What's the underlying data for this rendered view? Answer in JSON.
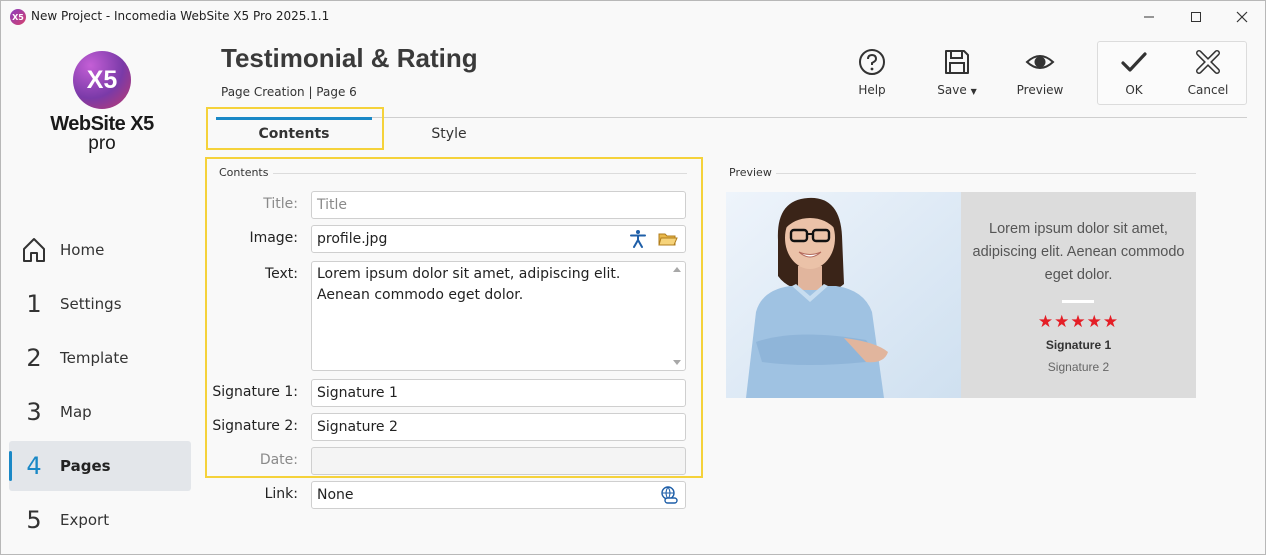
{
  "window": {
    "title": "New Project - Incomedia WebSite X5 Pro 2025.1.1",
    "app_icon_text": "X5"
  },
  "logo": {
    "mark": "X5",
    "name": "WebSite X5",
    "edition": "pro"
  },
  "sidebar": {
    "items": [
      {
        "num": "",
        "label": "Home",
        "icon": "home-icon"
      },
      {
        "num": "1",
        "label": "Settings"
      },
      {
        "num": "2",
        "label": "Template"
      },
      {
        "num": "3",
        "label": "Map"
      },
      {
        "num": "4",
        "label": "Pages",
        "active": true
      },
      {
        "num": "5",
        "label": "Export"
      }
    ]
  },
  "header": {
    "title": "Testimonial & Rating",
    "breadcrumb": "Page Creation | Page 6",
    "toolbar": {
      "help": "Help",
      "save": "Save",
      "preview": "Preview",
      "ok": "OK",
      "cancel": "Cancel"
    }
  },
  "tabs": [
    {
      "label": "Contents",
      "active": true
    },
    {
      "label": "Style",
      "active": false
    }
  ],
  "contents": {
    "section_title": "Contents",
    "title": {
      "label": "Title:",
      "placeholder": "Title"
    },
    "image": {
      "label": "Image:",
      "value": "profile.jpg"
    },
    "text": {
      "label": "Text:",
      "value": "Lorem ipsum dolor sit amet, adipiscing elit. Aenean commodo eget dolor."
    },
    "signature1": {
      "label": "Signature 1:",
      "value": "Signature 1"
    },
    "signature2": {
      "label": "Signature 2:",
      "value": "Signature 2"
    },
    "date": {
      "label": "Date:",
      "value": ""
    },
    "link": {
      "label": "Link:",
      "value": "None"
    }
  },
  "preview": {
    "section_title": "Preview",
    "quote": "Lorem ipsum dolor sit amet, adipiscing elit. Aenean commodo eget dolor.",
    "rating": 5,
    "rating_stars": "★★★★★",
    "signature1": "Signature 1",
    "signature2": "Signature 2",
    "star_color": "#e41e26"
  },
  "colors": {
    "accent": "#1a88c6",
    "highlight": "#f5d23b"
  }
}
